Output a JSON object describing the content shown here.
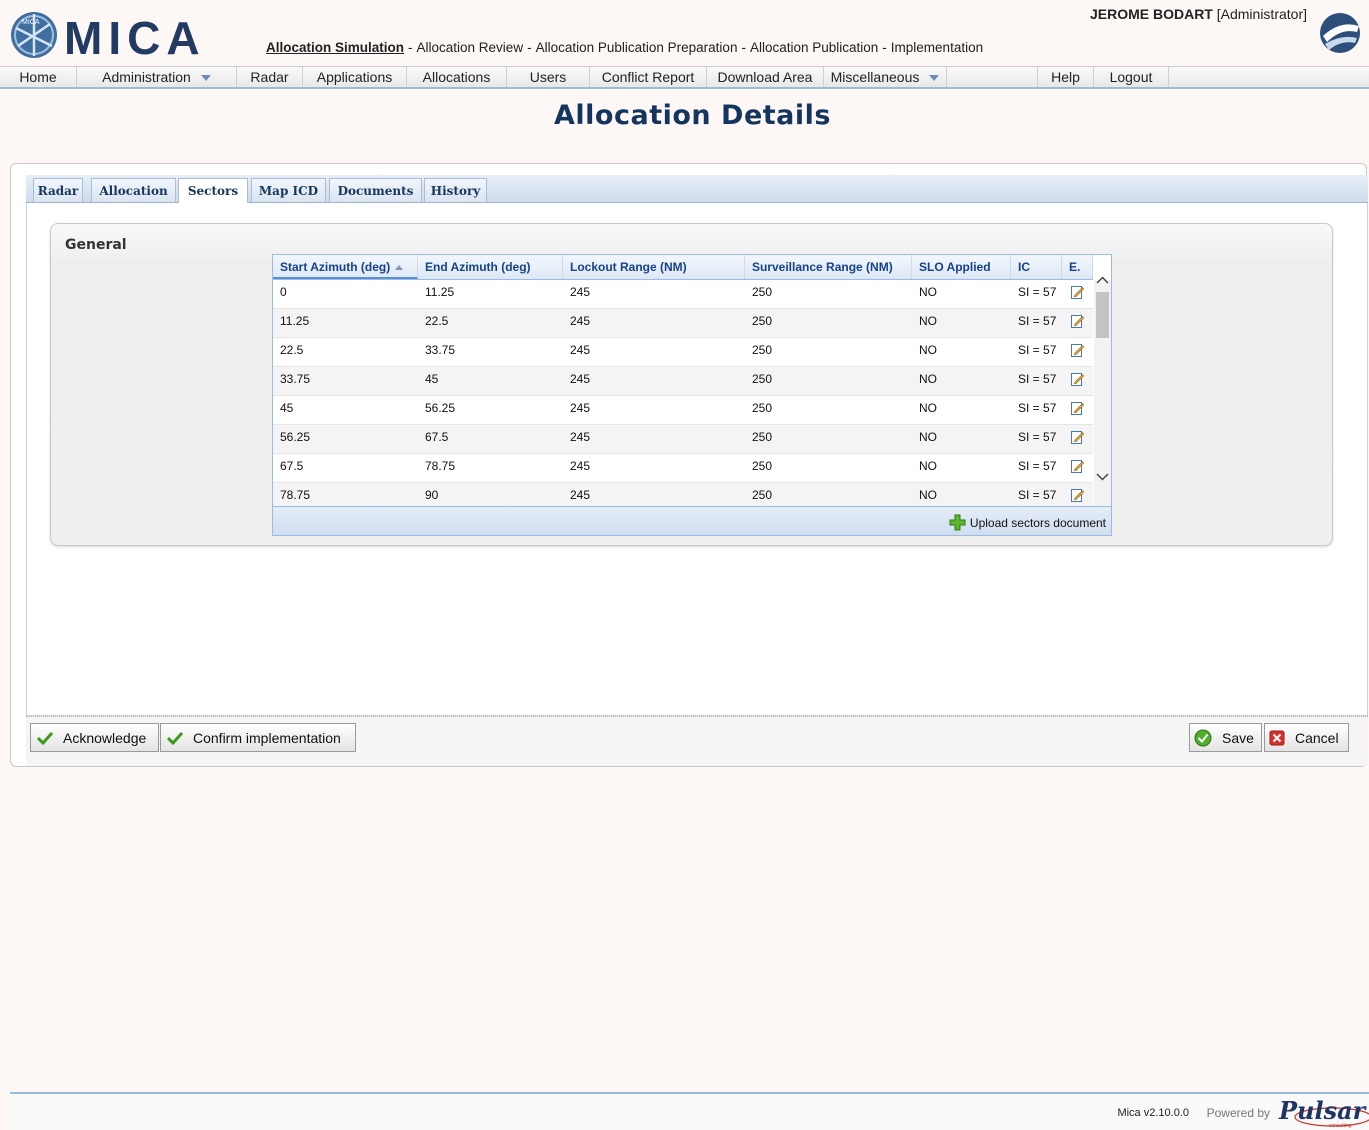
{
  "header": {
    "app_name": "MICA",
    "logo_small_text": "MICA",
    "user_name": "JEROME BODART",
    "user_role": "[Administrator]",
    "workflow": [
      {
        "label": "Allocation Simulation",
        "active": true
      },
      {
        "label": "Allocation Review",
        "active": false
      },
      {
        "label": "Allocation Publication Preparation",
        "active": false
      },
      {
        "label": "Allocation Publication",
        "active": false
      },
      {
        "label": "Implementation",
        "active": false
      }
    ],
    "workflow_separator": "-"
  },
  "menu": [
    {
      "label": "Home"
    },
    {
      "label": "Administration",
      "dropdown": true
    },
    {
      "label": "Radar"
    },
    {
      "label": "Applications"
    },
    {
      "label": "Allocations"
    },
    {
      "label": "Users"
    },
    {
      "label": "Conflict Report"
    },
    {
      "label": "Download Area"
    },
    {
      "label": "Miscellaneous",
      "dropdown": true
    },
    {
      "label": ""
    },
    {
      "label": "Help"
    },
    {
      "label": "Logout"
    }
  ],
  "page_title": "Allocation Details",
  "tabs": [
    {
      "label": "Radar",
      "active": false
    },
    {
      "label": "Allocation",
      "active": false
    },
    {
      "label": "Sectors",
      "active": true
    },
    {
      "label": "Map ICD",
      "active": false
    },
    {
      "label": "Documents",
      "active": false
    },
    {
      "label": "History",
      "active": false
    }
  ],
  "general_legend": "General",
  "sectors_grid": {
    "columns": [
      "Start Azimuth (deg)",
      "End Azimuth (deg)",
      "Lockout Range (NM)",
      "Surveillance Range (NM)",
      "SLO Applied",
      "IC",
      "E."
    ],
    "sorted_column": "Start Azimuth (deg)",
    "sort_direction": "ascending",
    "rows": [
      [
        "0",
        "11.25",
        "245",
        "250",
        "NO",
        "SI = 57"
      ],
      [
        "11.25",
        "22.5",
        "245",
        "250",
        "NO",
        "SI = 57"
      ],
      [
        "22.5",
        "33.75",
        "245",
        "250",
        "NO",
        "SI = 57"
      ],
      [
        "33.75",
        "45",
        "245",
        "250",
        "NO",
        "SI = 57"
      ],
      [
        "45",
        "56.25",
        "245",
        "250",
        "NO",
        "SI = 57"
      ],
      [
        "56.25",
        "67.5",
        "245",
        "250",
        "NO",
        "SI = 57"
      ],
      [
        "67.5",
        "78.75",
        "245",
        "250",
        "NO",
        "SI = 57"
      ],
      [
        "78.75",
        "90",
        "245",
        "250",
        "NO",
        "SI = 57"
      ]
    ],
    "upload_label": "Upload sectors document"
  },
  "buttons": {
    "acknowledge": "Acknowledge",
    "confirm": "Confirm implementation",
    "save": "Save",
    "cancel": "Cancel"
  },
  "footer": {
    "version": "Mica v2.10.0.0",
    "powered_by": "Powered by",
    "pulsar_brand": "Pulsar",
    "pulsar_sub": "consulting"
  },
  "colors": {
    "title": "#14365e",
    "accent": "#9bb9da",
    "tab_text": "#17365d",
    "check_green": "#3a9a1a",
    "cancel_red": "#d9302b"
  }
}
